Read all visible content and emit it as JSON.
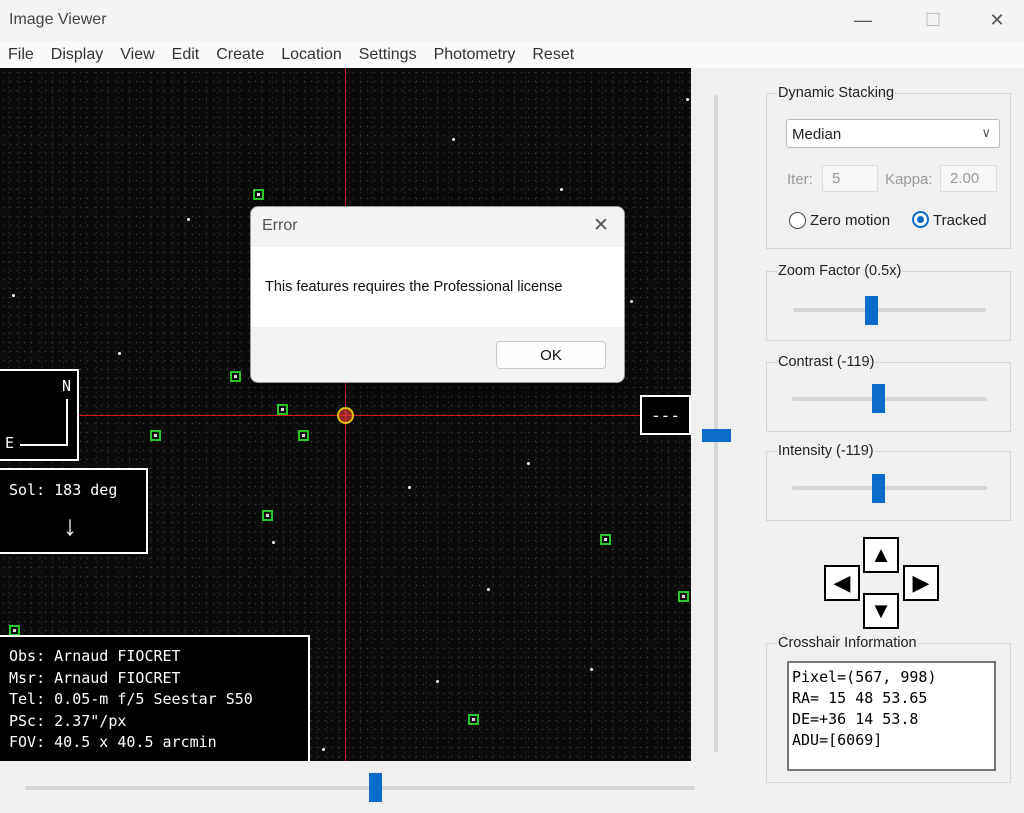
{
  "window": {
    "title": "Image Viewer",
    "min_icon": "—",
    "max_icon": "☐",
    "close_icon": "✕"
  },
  "menu": [
    "File",
    "Display",
    "View",
    "Edit",
    "Create",
    "Location",
    "Settings",
    "Photometry",
    "Reset"
  ],
  "overlay": {
    "compass": {
      "north": "N",
      "east": "E"
    },
    "sol": {
      "label": "Sol: 183 deg",
      "arrow": "↓"
    },
    "readout": "---",
    "info": [
      "Obs: Arnaud FIOCRET",
      "Msr: Arnaud FIOCRET",
      "Tel: 0.05-m f/5 Seestar S50",
      "PSc: 2.37\"/px",
      "FOV: 40.5 x 40.5 arcmin"
    ]
  },
  "dynamic_stacking": {
    "title": "Dynamic Stacking",
    "method": "Median",
    "iter_label": "Iter:",
    "iter_value": "5",
    "kappa_label": "Kappa:",
    "kappa_value": "2.00",
    "radio_zero": "Zero motion",
    "radio_tracked": "Tracked",
    "selected": "Tracked"
  },
  "zoom": {
    "title": "Zoom Factor (0.5x)",
    "level": 0.4
  },
  "contrast": {
    "title": "Contrast (-119)",
    "level": 0.44
  },
  "intensity": {
    "title": "Intensity (-119)",
    "level": 0.44
  },
  "nav_arrows": {
    "up": "▲",
    "down": "▼",
    "left": "◀",
    "right": "▶"
  },
  "crosshair": {
    "title": "Crosshair Information",
    "lines": [
      "Pixel=(567, 998)",
      "RA= 15 48 53.65",
      "DE=+36 14 53.8",
      "ADU=[6069]"
    ]
  },
  "vertical_slider": {
    "level": 0.51
  },
  "horizontal_slider": {
    "level": 0.52
  },
  "dialog": {
    "title": "Error",
    "close_icon": "✕",
    "message": "This features requires the Professional license",
    "ok_label": "OK"
  }
}
